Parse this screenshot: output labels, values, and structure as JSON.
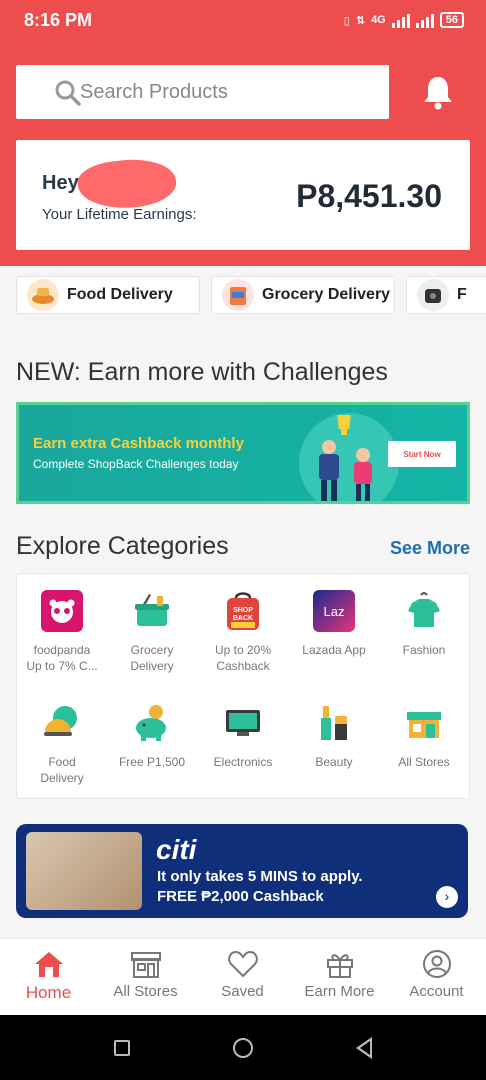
{
  "status_bar": {
    "time": "8:16 PM",
    "network": "4G",
    "battery": "56"
  },
  "header": {
    "search_placeholder": "Search Products",
    "greeting": "Hey",
    "earnings_label": "Your Lifetime Earnings:",
    "earnings_amount": "P8,451.30"
  },
  "quick_links": [
    {
      "label": "Food Delivery",
      "icon": "food-delivery-icon"
    },
    {
      "label": "Grocery Delivery",
      "icon": "grocery-icon"
    },
    {
      "label": "F",
      "icon": "appliance-icon"
    }
  ],
  "challenges": {
    "heading": "NEW: Earn more with Challenges",
    "banner_title": "Earn extra Cashback monthly",
    "banner_subtitle": "Complete ShopBack Challenges today",
    "banner_button": "Start Now"
  },
  "categories": {
    "heading": "Explore Categories",
    "see_more": "See More",
    "items": [
      {
        "line1": "foodpanda",
        "line2": "Up to 7% C...",
        "icon": "foodpanda-icon"
      },
      {
        "line1": "Grocery",
        "line2": "Delivery",
        "icon": "basket-icon"
      },
      {
        "line1": "Up to 20%",
        "line2": "Cashback",
        "icon": "shopback-mall-icon"
      },
      {
        "line1": "Lazada App",
        "line2": "",
        "icon": "lazada-icon"
      },
      {
        "line1": "Fashion",
        "line2": "",
        "icon": "shirt-icon"
      },
      {
        "line1": "Food",
        "line2": "Delivery",
        "icon": "food-icon"
      },
      {
        "line1": "Free P1,500",
        "line2": "",
        "icon": "piggy-bank-icon"
      },
      {
        "line1": "Electronics",
        "line2": "",
        "icon": "monitor-icon"
      },
      {
        "line1": "Beauty",
        "line2": "",
        "icon": "cosmetics-icon"
      },
      {
        "line1": "All Stores",
        "line2": "",
        "icon": "store-icon"
      }
    ]
  },
  "promo": {
    "logo": "citi",
    "line1": "It only takes 5 MINS to apply.",
    "line2": "FREE ₱2,000 Cashback"
  },
  "tabs": [
    {
      "label": "Home",
      "icon": "home-icon",
      "active": true
    },
    {
      "label": "All Stores",
      "icon": "store-icon",
      "active": false
    },
    {
      "label": "Saved",
      "icon": "heart-icon",
      "active": false
    },
    {
      "label": "Earn More",
      "icon": "gift-icon",
      "active": false
    },
    {
      "label": "Account",
      "icon": "account-icon",
      "active": false
    }
  ],
  "colors": {
    "brand": "#ee4d4d",
    "link": "#1f6fb3",
    "citi": "#0f2f7a",
    "banner": "#14b5a6"
  }
}
